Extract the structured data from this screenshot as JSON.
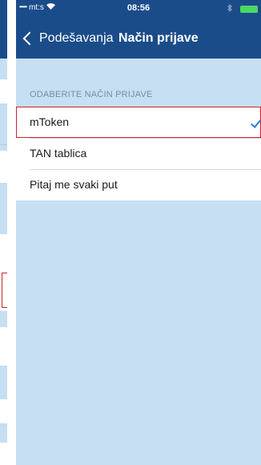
{
  "status_bar": {
    "signal": "•••••",
    "carrier": "mt:s",
    "time": "08:56",
    "battery_color": "#4cd964"
  },
  "nav": {
    "back_label": "Podešavanja",
    "title": "Način prijave",
    "background": "#1b4c8a"
  },
  "section": {
    "header": "ODABERITE NAČIN PRIJAVE"
  },
  "options": [
    {
      "label": "mToken",
      "selected": true
    },
    {
      "label": "TAN tablica",
      "selected": false
    },
    {
      "label": "Pitaj me svaki put",
      "selected": false
    }
  ],
  "colors": {
    "page_background": "#c6dff2",
    "selection_border": "#d0202b",
    "checkmark": "#2a7de1"
  },
  "icons": {
    "wifi": "wifi-icon",
    "bluetooth": "bluetooth-icon",
    "battery": "battery-icon",
    "back": "chevron-left-icon",
    "selected": "checkmark-icon"
  }
}
